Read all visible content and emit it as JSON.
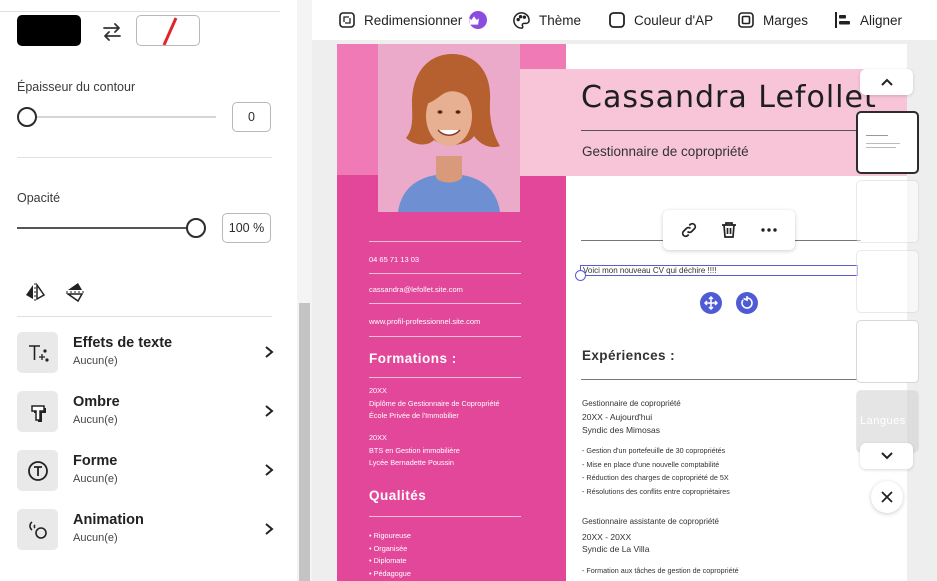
{
  "panel": {
    "stroke_width": {
      "label": "Épaisseur du contour",
      "value": "0"
    },
    "opacity": {
      "label": "Opacité",
      "value": "100 %"
    },
    "properties": [
      {
        "title": "Effets de texte",
        "value": "Aucun(e)",
        "icon": "text-effects-icon"
      },
      {
        "title": "Ombre",
        "value": "Aucun(e)",
        "icon": "shadow-icon"
      },
      {
        "title": "Forme",
        "value": "Aucun(e)",
        "icon": "shape-icon"
      },
      {
        "title": "Animation",
        "value": "Aucun(e)",
        "icon": "animation-icon"
      }
    ]
  },
  "toolbar": {
    "resize": "Redimensionner",
    "theme": "Thème",
    "background_color": "Couleur d'AP",
    "margins": "Marges",
    "align": "Aligner"
  },
  "cv": {
    "name": "Cassandra Lefollet",
    "job_title": "Gestionnaire de copropriété",
    "phone": "04 65 71 13 03",
    "email": "cassandra@lefollet.site.com",
    "website": "www.profil-professionnel.site.com",
    "formations_heading": "Formations :",
    "formations": [
      {
        "year": "20XX",
        "line1": "Diplôme de Gestionnaire de Copropriété",
        "line2": "École Privée de l'Immobilier"
      },
      {
        "year": "20XX",
        "line1": "BTS en Gestion immobilière",
        "line2": "Lycée Bernadette Poussin"
      }
    ],
    "qualities_heading": "Qualités",
    "qualities": [
      "• Rigoureuse",
      "• Organisée",
      "• Diplomate",
      "• Pédagogue"
    ],
    "selected_text": "Voici mon nouveau CV qui déchire !!!!",
    "experiences_heading": "Expériences :",
    "experience1": {
      "title": "Gestionnaire de copropriété",
      "dates": "20XX - Aujourd'hui",
      "company": "Syndic des Mimosas",
      "bullets": [
        "- Gestion d'un portefeuille de 30 copropriétés",
        "- Mise en place d'une nouvelle comptabilité",
        "- Réduction des charges de copropriété de 5X",
        "- Résolutions des conflits entre copropriétaires"
      ]
    },
    "experience2": {
      "title": "Gestionnaire assistante de copropriété",
      "dates": "20XX - 20XX",
      "company": "Syndic de La Villa",
      "bullets": [
        "- Formation aux tâches de gestion de copropriété"
      ]
    }
  },
  "thumbnails": {
    "languages_label": "Langues"
  },
  "colors": {
    "pink": "#e2479a",
    "light_pink": "#f7c4d8",
    "accent": "#5b5bd6",
    "crown": "#8b4ce0"
  }
}
